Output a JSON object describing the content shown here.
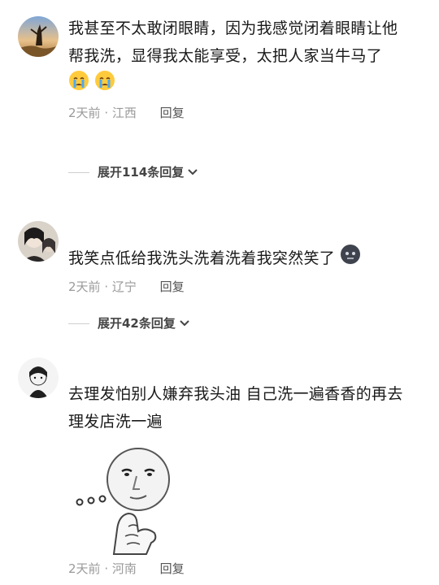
{
  "comments": [
    {
      "text_line1": "我甚至不太敢闭眼睛，因为我感觉闭着眼睛让他",
      "text_line2": "帮我洗，显得我太能享受，太把人家当牛马了",
      "emojis": [
        "crying-face",
        "crying-face"
      ],
      "time": "2天前",
      "location": "江西",
      "reply_label": "回复",
      "expand_label": "展开114条回复"
    },
    {
      "text_line1": "我笑点低给我洗头洗着洗着我突然笑了",
      "emojis": [
        "dark-face"
      ],
      "time": "2天前",
      "location": "辽宁",
      "reply_label": "回复",
      "expand_label": "展开42条回复"
    },
    {
      "text_line1": "去理发怕别人嫌弃我头油 自己洗一遍香香的再去",
      "text_line2": "理发店洗一遍",
      "sticker": "thinking-face-meme",
      "time": "2天前",
      "location": "河南",
      "reply_label": "回复"
    }
  ],
  "meta_separator": " · "
}
